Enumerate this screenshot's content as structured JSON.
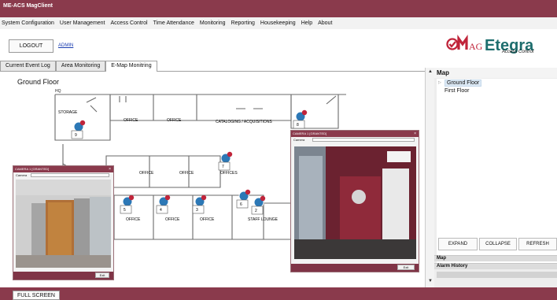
{
  "app": {
    "title": "ME-ACS MagClient"
  },
  "menu": [
    "System Configuration",
    "User Management",
    "Access Control",
    "Time Attendance",
    "Monitoring",
    "Reporting",
    "Housekeeping",
    "Help",
    "About"
  ],
  "header": {
    "logout_label": "LOGOUT",
    "user": "ADMIN",
    "logo_text": "MAGEtegra",
    "logo_tagline": "Access Control"
  },
  "tabs": [
    "Current Event Log",
    "Area Monitoring",
    "E-Map Monitring"
  ],
  "map": {
    "floor_title": "Ground Floor",
    "building_label": "HQ",
    "rooms": {
      "storage": "STORAGE",
      "office1": "OFFICE",
      "office2": "OFFICE",
      "cataloging": "CATALOGING / ACQUISITIONS",
      "office3": "OFFICE",
      "office4": "OFFICE",
      "offices": "OFFICES",
      "office5": "OFFICE",
      "office6": "OFFICE",
      "office7": "OFFICE",
      "lounge": "STAFF LOUNGE"
    },
    "doors": [
      "9",
      "8",
      "7",
      "5",
      "4",
      "3",
      "6",
      "2"
    ]
  },
  "right_panel": {
    "title": "Map",
    "tree": [
      "Ground Floor",
      "First Floor"
    ],
    "buttons": {
      "expand": "EXPAND",
      "collapse": "COLLAPSE",
      "refresh": "REFRESH"
    },
    "accordion": [
      "Map",
      "Alarm History"
    ]
  },
  "camera_windows": [
    {
      "title": "CAMERA 1 [GRANTED]",
      "field_label": "Camera",
      "exit": "Exit"
    },
    {
      "title": "CAMERA 1 [GRANTED]",
      "field_label": "Camera",
      "exit": "Exit"
    }
  ],
  "footer": {
    "fullscreen_label": "FULL SCREEN"
  },
  "colors": {
    "brand": "#8a3a4c",
    "logo_red": "#c0243a",
    "logo_teal": "#1e6e6e",
    "selection": "#dce9f5"
  }
}
